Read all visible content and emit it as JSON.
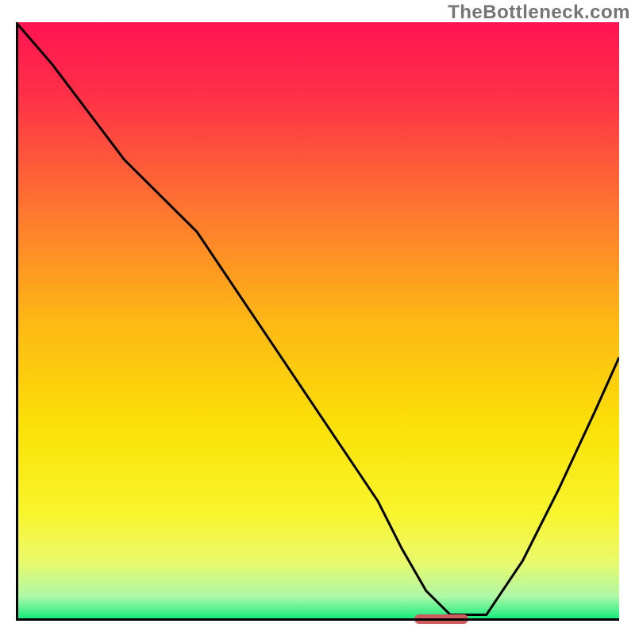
{
  "watermark": "TheBottleneck.com",
  "chart_data": {
    "type": "line",
    "title": "",
    "xlabel": "",
    "ylabel": "",
    "xlim": [
      0,
      100
    ],
    "ylim": [
      0,
      100
    ],
    "grid": false,
    "axes": {
      "left": true,
      "bottom": true,
      "right": false,
      "top": false
    },
    "gradient_stops": [
      {
        "offset": 0.0,
        "color": "#FF1451"
      },
      {
        "offset": 0.12,
        "color": "#FF2F48"
      },
      {
        "offset": 0.3,
        "color": "#FE7131"
      },
      {
        "offset": 0.5,
        "color": "#FDB814"
      },
      {
        "offset": 0.68,
        "color": "#FBE207"
      },
      {
        "offset": 0.82,
        "color": "#F8F52D"
      },
      {
        "offset": 0.9,
        "color": "#EBF969"
      },
      {
        "offset": 0.96,
        "color": "#AEF8A8"
      },
      {
        "offset": 1.0,
        "color": "#07EB79"
      }
    ],
    "series": [
      {
        "name": "bottleneck-curve",
        "color": "#000000",
        "x": [
          0,
          6,
          12,
          18,
          24,
          30,
          36,
          42,
          48,
          54,
          60,
          64,
          68,
          72,
          78,
          84,
          90,
          96,
          100
        ],
        "y": [
          100,
          93,
          85,
          77,
          71,
          65,
          56,
          47,
          38,
          29,
          20,
          12,
          5,
          1,
          1,
          10,
          22,
          35,
          44
        ]
      }
    ],
    "marker": {
      "x_start": 66,
      "x_end": 75,
      "y": 0.5,
      "color": "#CD5C5C"
    }
  }
}
